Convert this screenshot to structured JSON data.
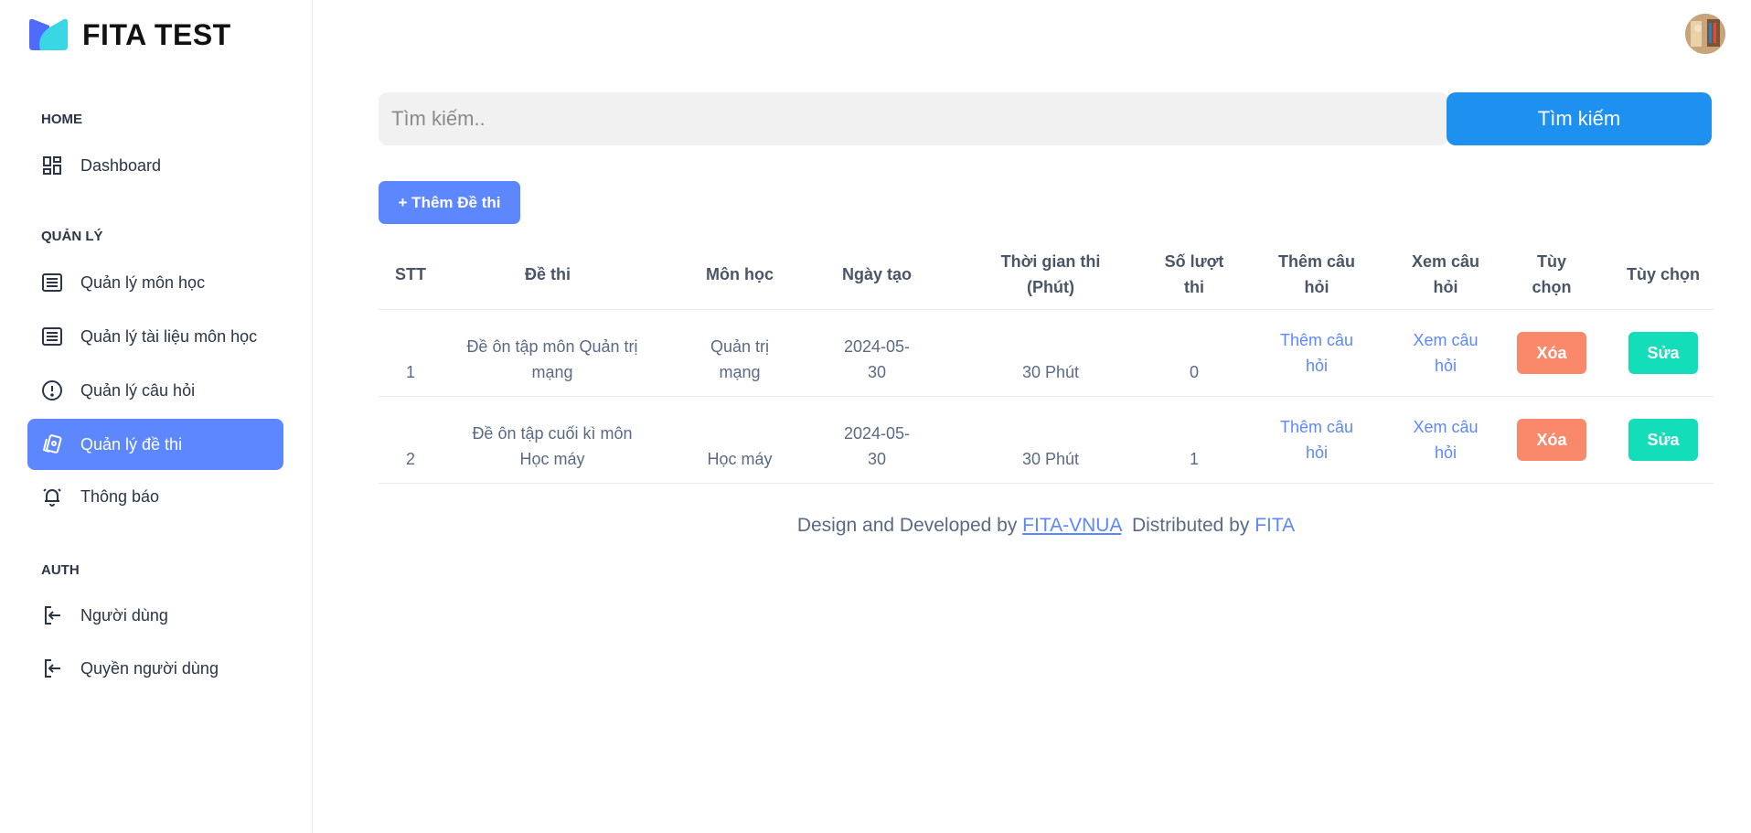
{
  "brand": {
    "name": "FITA TEST",
    "colors": {
      "logo_blue": "#4f6bff",
      "logo_cyan": "#39d7e6"
    }
  },
  "sidebar": {
    "sections": [
      {
        "title": "HOME"
      },
      {
        "title": "QUẢN LÝ"
      },
      {
        "title": "AUTH"
      }
    ],
    "items": [
      {
        "label": "Dashboard",
        "icon": "dashboard-icon"
      },
      {
        "label": "Quản lý môn học",
        "icon": "list-icon"
      },
      {
        "label": "Quản lý tài liệu môn học",
        "icon": "list-icon"
      },
      {
        "label": "Quản lý câu hỏi",
        "icon": "alert-circle-icon"
      },
      {
        "label": "Quản lý đề thi",
        "icon": "cards-icon",
        "active": true
      },
      {
        "label": "Thông báo",
        "icon": "bell-icon"
      },
      {
        "label": "Người dùng",
        "icon": "login-icon"
      },
      {
        "label": "Quyền người dùng",
        "icon": "login-icon"
      }
    ]
  },
  "search": {
    "placeholder": "Tìm kiếm..",
    "value": "",
    "button_label": "Tìm kiếm"
  },
  "add_button_label": "+ Thêm Đề thi",
  "table": {
    "headers": [
      "STT",
      "Đề thi",
      "Môn học",
      "Ngày tạo",
      "Thời gian thi (Phút)",
      "Số lượt thi",
      "Thêm câu hỏi",
      "Xem câu hỏi",
      "Tùy chọn",
      "Tùy chọn"
    ],
    "rows": [
      {
        "stt": "1",
        "exam": "Đề ôn tập môn Quản trị mạng",
        "subject": "Quản trị mạng",
        "created": "2024-05-30",
        "duration": "30 Phút",
        "attempts": "0",
        "add_question": "Thêm câu hỏi",
        "view_question": "Xem câu hỏi",
        "delete": "Xóa",
        "edit": "Sửa"
      },
      {
        "stt": "2",
        "exam": "Đề ôn tập cuối kì môn Học máy",
        "subject": "Học máy",
        "created": "2024-05-30",
        "duration": "30 Phút",
        "attempts": "1",
        "add_question": "Thêm câu hỏi",
        "view_question": "Xem câu hỏi",
        "delete": "Xóa",
        "edit": "Sửa"
      }
    ]
  },
  "footer": {
    "prefix": "Design and Developed by",
    "link1": "FITA-VNUA",
    "middle": "Distributed by",
    "link2": "FITA"
  },
  "colors": {
    "primary": "#5d87ff",
    "search_button": "#1e90f0",
    "danger": "#fa896b",
    "success": "#13deb9"
  }
}
